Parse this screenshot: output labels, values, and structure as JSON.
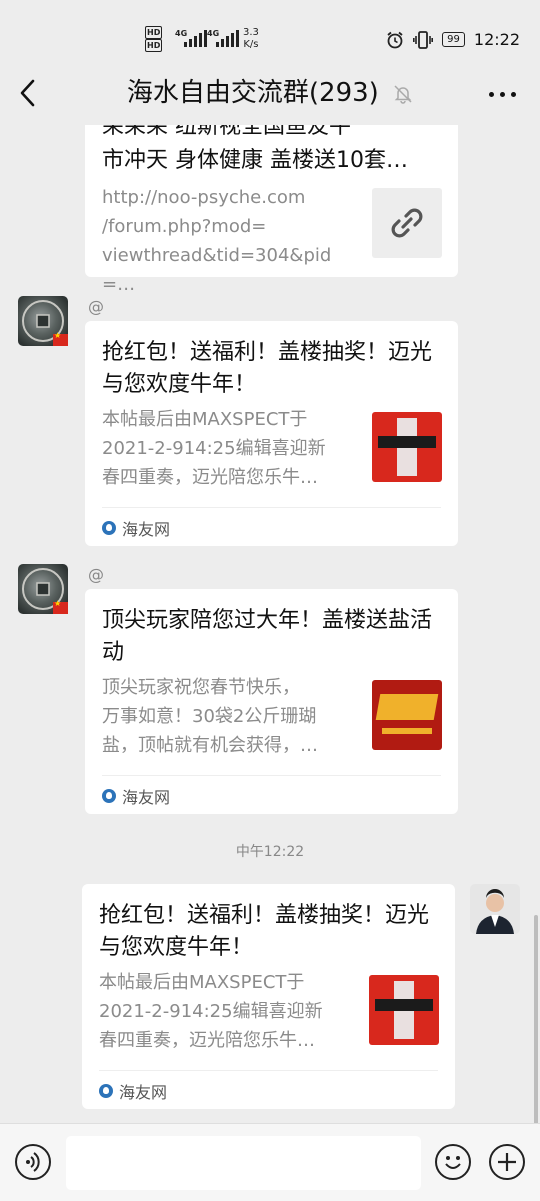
{
  "status_bar": {
    "hd1": "HD",
    "hd2": "HD",
    "net1": "4G",
    "net2": "4G",
    "speed_value": "3.3",
    "speed_unit": "K/s",
    "battery": "99",
    "time": "12:22",
    "icons": [
      "alarm-icon",
      "vibrate-icon",
      "battery-icon",
      "signal-icon"
    ]
  },
  "nav": {
    "title": "海水自由交流群(293)",
    "icons": [
      "back-icon",
      "mute-icon",
      "more-icon"
    ]
  },
  "messages": [
    {
      "title_partial": "呆呆呆 纽斯视全国鱼友牛",
      "title": "市冲天 身体健康 盖楼送10套…",
      "desc_lines": [
        "http://noo-psyche.com",
        "/forum.php?mod=",
        "viewthread&tid=304&pid=…"
      ],
      "thumb_icon": "link-icon"
    },
    {
      "at": "@",
      "title": "抢红包！送福利！盖楼抽奖！迈光与您欢度牛年！",
      "desc_lines": [
        "本帖最后由MAXSPECT于",
        "2021-2-914:25编辑喜迎新",
        "春四重奏，迈光陪您乐牛…"
      ],
      "source": "海友网"
    },
    {
      "at": "@",
      "title": "顶尖玩家陪您过大年！盖楼送盐活动",
      "desc_lines": [
        "顶尖玩家祝您春节快乐，",
        "万事如意！30袋2公斤珊瑚",
        "盐，顶帖就有机会获得，…"
      ],
      "source": "海友网"
    },
    {
      "timestamp": "中午12:22",
      "title": "抢红包！送福利！盖楼抽奖！迈光与您欢度牛年！",
      "desc_lines": [
        "本帖最后由MAXSPECT于",
        "2021-2-914:25编辑喜迎新",
        "春四重奏，迈光陪您乐牛…"
      ],
      "source": "海友网"
    }
  ],
  "input_bar": {
    "icons": [
      "voice-icon",
      "emoji-icon",
      "plus-icon"
    ],
    "input_value": ""
  },
  "colors": {
    "background": "#ededed",
    "card": "#ffffff",
    "source_icon": "#2c73b9",
    "thumb_red": "#d8281d"
  }
}
